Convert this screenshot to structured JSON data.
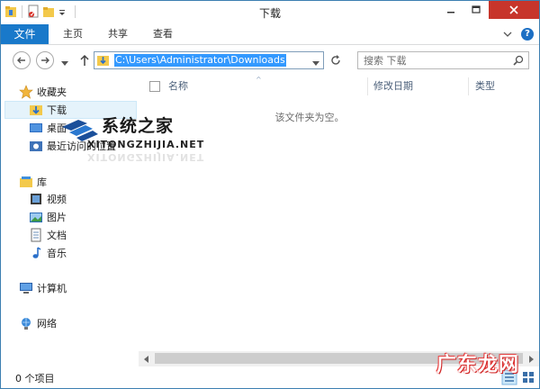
{
  "window": {
    "title": "下载"
  },
  "ribbon": {
    "tabs": [
      {
        "label": "文件"
      },
      {
        "label": "主页"
      },
      {
        "label": "共享"
      },
      {
        "label": "查看"
      }
    ],
    "help_label": "?"
  },
  "address": {
    "path": "C:\\Users\\Administrator\\Downloads"
  },
  "search": {
    "placeholder": "搜索 下载"
  },
  "nav": {
    "favorites": {
      "label": "收藏夹",
      "items": [
        {
          "label": "下载",
          "icon": "downloads-folder-icon",
          "selected": true
        },
        {
          "label": "桌面",
          "icon": "desktop-icon"
        },
        {
          "label": "最近访问的位置",
          "icon": "recent-places-icon"
        }
      ]
    },
    "libraries": {
      "label": "库",
      "items": [
        {
          "label": "视频",
          "icon": "videos-icon"
        },
        {
          "label": "图片",
          "icon": "pictures-icon"
        },
        {
          "label": "文档",
          "icon": "documents-icon"
        },
        {
          "label": "音乐",
          "icon": "music-icon"
        }
      ]
    },
    "computer": {
      "label": "计算机"
    },
    "network": {
      "label": "网络"
    }
  },
  "content": {
    "columns": [
      {
        "label": "名称"
      },
      {
        "label": "修改日期"
      },
      {
        "label": "类型"
      }
    ],
    "empty_message": "该文件夹为空。"
  },
  "status": {
    "item_count": "0 个项目"
  },
  "watermarks": {
    "brand": "系统之家",
    "url": "XITONGZHIJIA.NET",
    "corner": "广东龙网"
  },
  "colors": {
    "accent": "#1979ca",
    "close_button": "#c7352b",
    "selection": "#e5f3fb",
    "address_highlight": "#3399ff"
  }
}
